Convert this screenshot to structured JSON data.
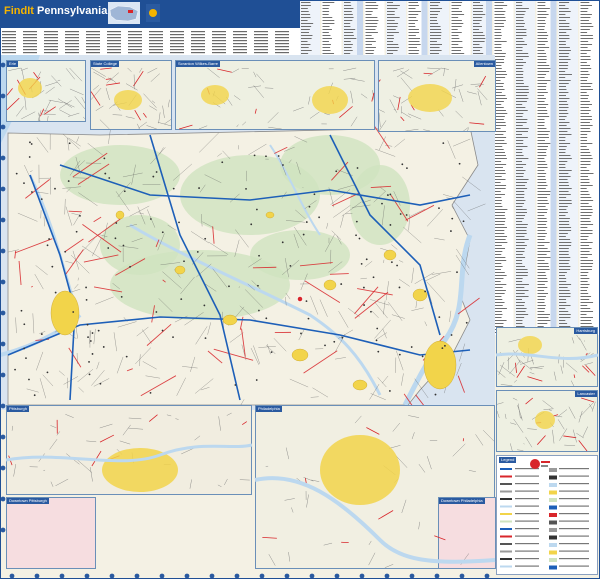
{
  "title": {
    "brand": "FindIt",
    "state": "Pennsylvania"
  },
  "insets": [
    {
      "label": "Erie"
    },
    {
      "label": "State College"
    },
    {
      "label": "Scranton Wilkes-Barre"
    },
    {
      "label": "Allentown"
    },
    {
      "label": "Harrisburg"
    },
    {
      "label": "Lancaster"
    },
    {
      "label": "Pittsburgh"
    },
    {
      "label": "Downtown Pittsburgh"
    },
    {
      "label": "Philadelphia"
    },
    {
      "label": "Downtown Philadelphia"
    }
  ],
  "legend": {
    "title": "Legend"
  },
  "colors": {
    "water": "#bcd8ef",
    "land": "#f4f1e4",
    "urban": "#f2d44a",
    "forest": "#cfe3bf",
    "interstate": "#1d5fb8",
    "us_highway": "#d8262b",
    "state_road": "#555555",
    "frame": "#1f4f95",
    "index_header": "#2a5aa0"
  }
}
